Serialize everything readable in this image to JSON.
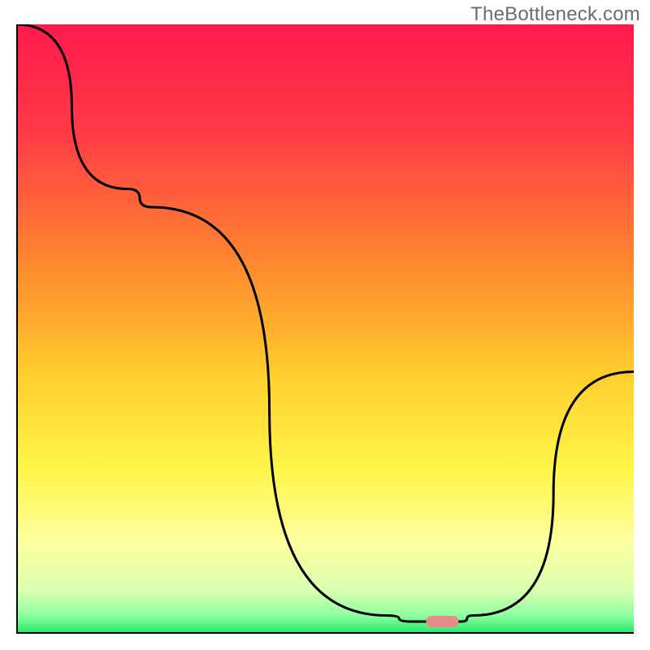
{
  "watermark": "TheBottleneck.com",
  "chart_data": {
    "type": "line",
    "title": "",
    "xlabel": "",
    "ylabel": "",
    "xlim": [
      0,
      100
    ],
    "ylim": [
      0,
      100
    ],
    "gradient_stops": [
      {
        "offset": 0,
        "color": "#ff1a4d"
      },
      {
        "offset": 18,
        "color": "#ff3b46"
      },
      {
        "offset": 40,
        "color": "#ff8b2e"
      },
      {
        "offset": 58,
        "color": "#ffcf2e"
      },
      {
        "offset": 73,
        "color": "#fff54a"
      },
      {
        "offset": 85,
        "color": "#fcffa0"
      },
      {
        "offset": 93,
        "color": "#d9ffb0"
      },
      {
        "offset": 97,
        "color": "#8effa0"
      },
      {
        "offset": 100,
        "color": "#1ee86a"
      }
    ],
    "series": [
      {
        "name": "bottleneck-curve",
        "x": [
          0,
          18,
          22,
          60,
          64,
          72,
          74,
          100
        ],
        "y": [
          100,
          73,
          70,
          3,
          2,
          2,
          3,
          43
        ]
      }
    ],
    "marker": {
      "name": "optimal-point",
      "x": 69,
      "y": 2,
      "color": "#e88a86"
    }
  }
}
